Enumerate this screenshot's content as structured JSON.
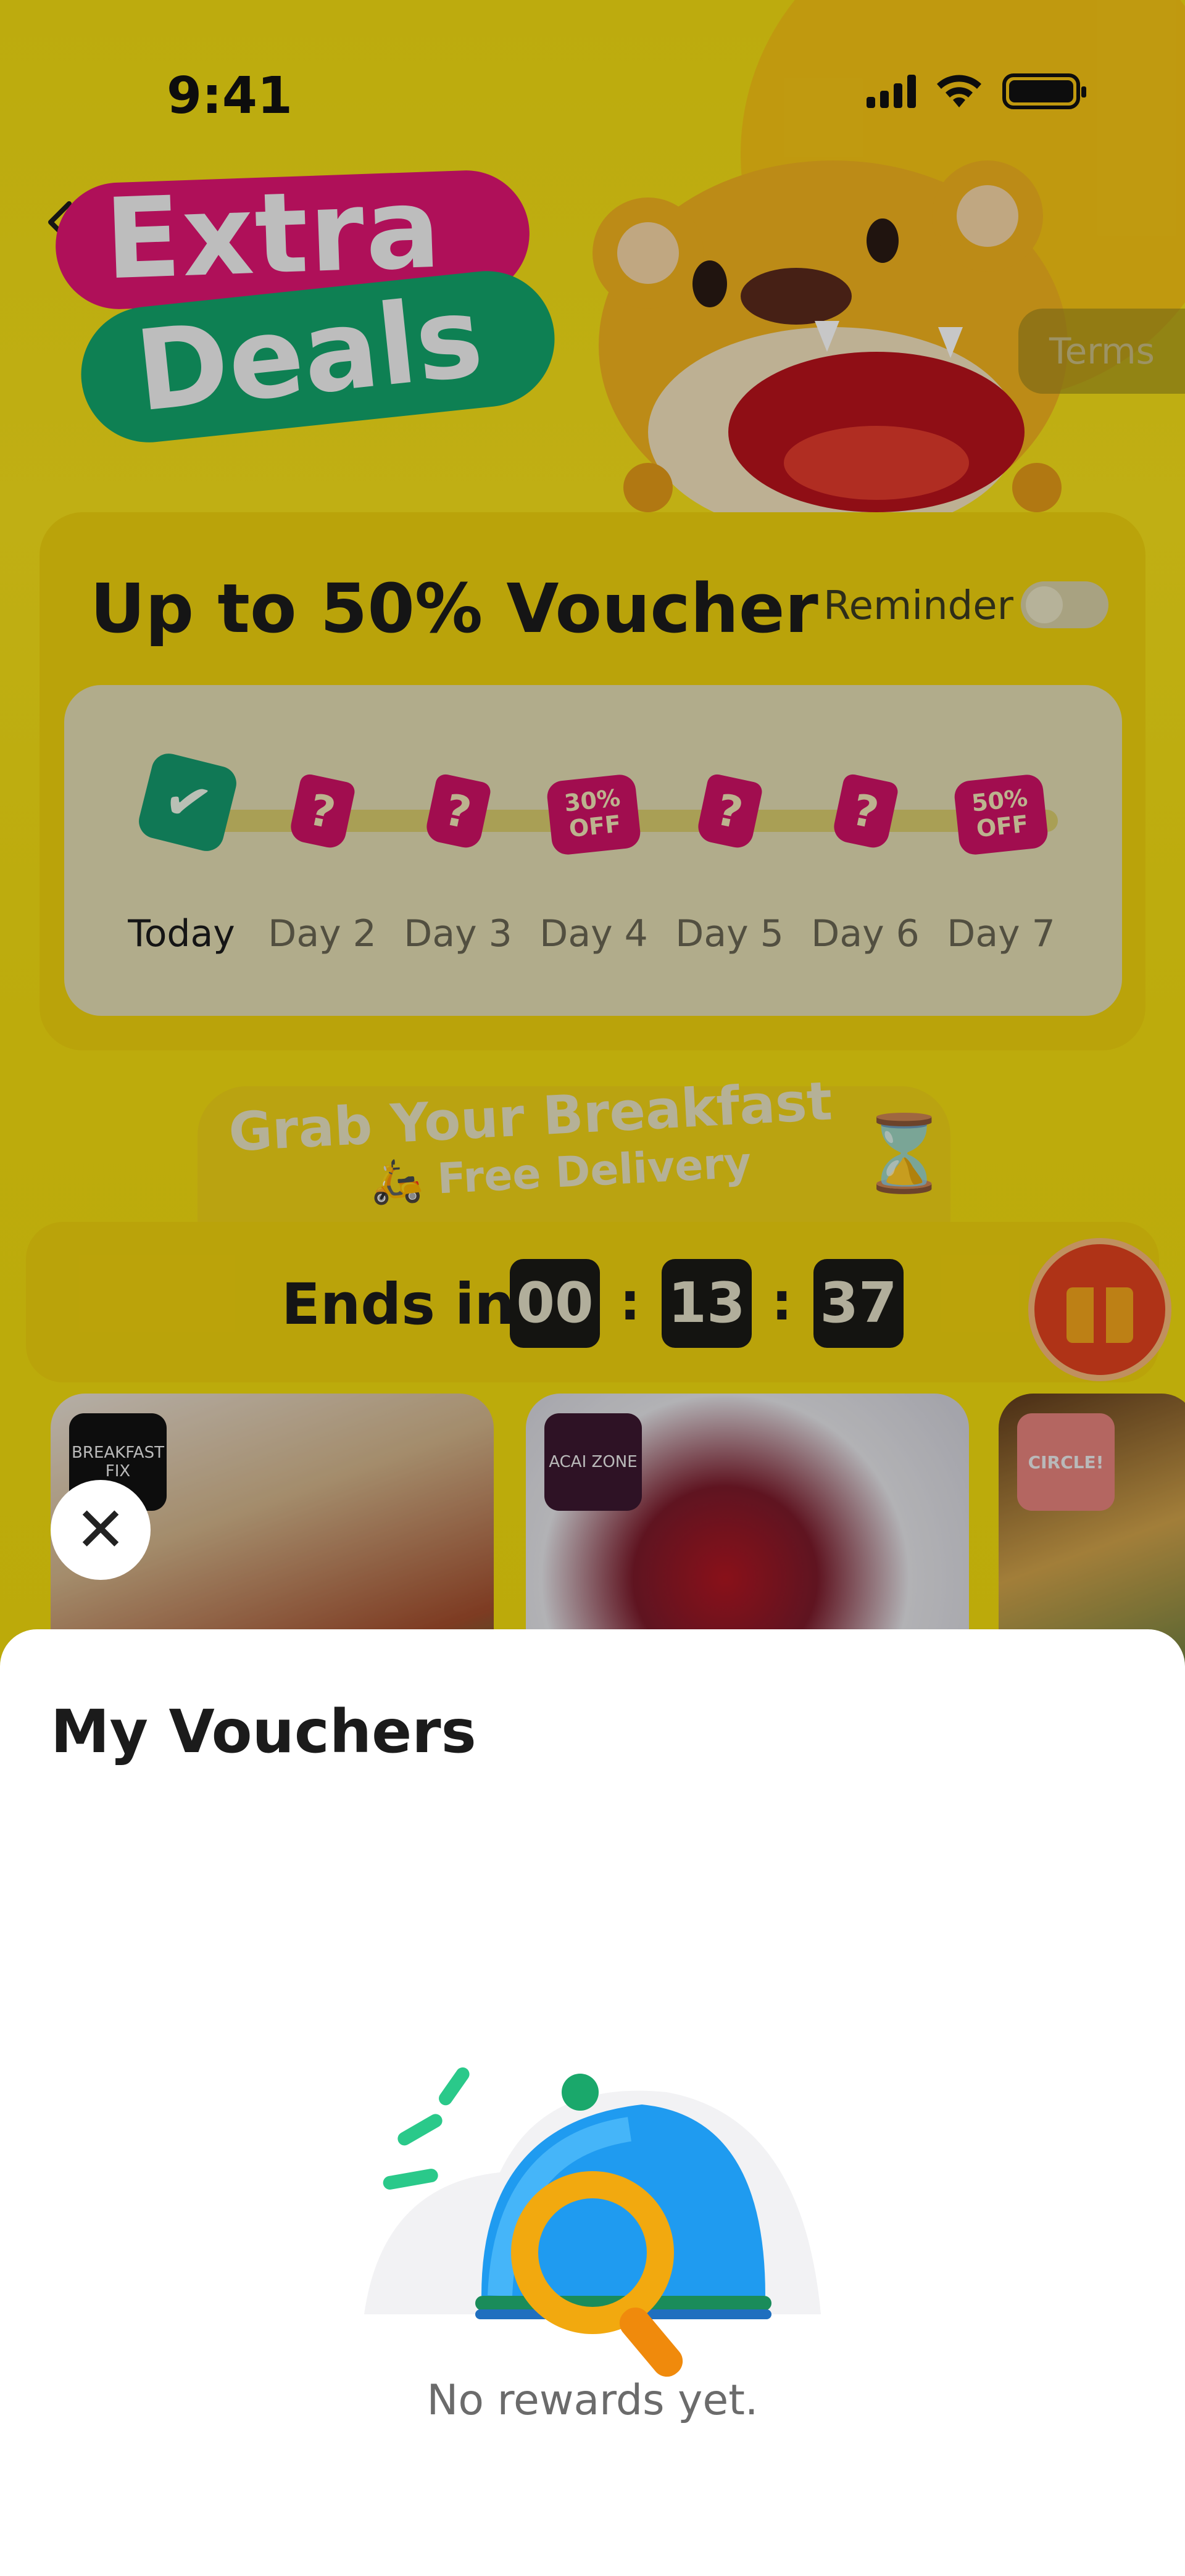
{
  "status_bar": {
    "time": "9:41"
  },
  "header": {
    "extra_word": "Extra",
    "deals_word": "Deals",
    "terms_label": "Terms"
  },
  "voucher_card": {
    "title": "Up to 50% Voucher",
    "reminder_label": "Reminder",
    "reminder_on": false,
    "days": [
      {
        "label": "Today",
        "marker": "check"
      },
      {
        "label": "Day 2",
        "marker": "?"
      },
      {
        "label": "Day 3",
        "marker": "?"
      },
      {
        "label": "Day 4",
        "marker": "30% OFF"
      },
      {
        "label": "Day 5",
        "marker": "?"
      },
      {
        "label": "Day 6",
        "marker": "?"
      },
      {
        "label": "Day 7",
        "marker": "50% OFF"
      }
    ]
  },
  "breakfast_banner": {
    "title": "Grab Your Breakfast",
    "subtitle": "Free Delivery"
  },
  "timer": {
    "label": "Ends in",
    "hours": "00",
    "minutes": "13",
    "seconds": "37"
  },
  "restaurants": [
    {
      "logo_text": "BREAKFAST FIX"
    },
    {
      "logo_text": "ACAI ZONE"
    },
    {
      "logo_text": "CIRCLE!"
    }
  ],
  "sheet": {
    "title": "My Vouchers",
    "empty_text": "No rewards yet."
  },
  "colors": {
    "brand_yellow": "#f2dc12",
    "extra_pink": "#e01573",
    "deals_green": "#13a56b",
    "gift_orange": "#e0421e"
  }
}
